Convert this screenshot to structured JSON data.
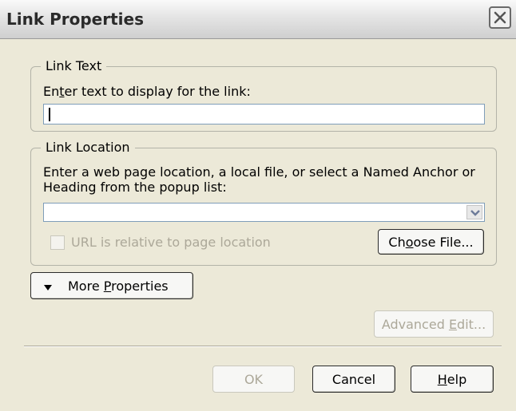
{
  "dialog": {
    "title": "Link Properties",
    "close_icon": "close-icon"
  },
  "link_text": {
    "legend": "Link Text",
    "prompt_pre": "En",
    "prompt_key": "t",
    "prompt_post": "er text to display for the link:",
    "value": ""
  },
  "link_location": {
    "legend": "Link Location",
    "prompt_line1": "Enter a web page location, a local file, or select a Named Anchor or",
    "prompt_line2": "Heading from the popup list:",
    "value": "",
    "relative_label": "URL is relative to page location",
    "relative_checked": false,
    "choose_pre": "Ch",
    "choose_key": "o",
    "choose_post": "ose File..."
  },
  "more_properties": {
    "pre": "More ",
    "key": "P",
    "post": "roperties"
  },
  "advanced_edit": {
    "pre": "Advanced ",
    "key": "E",
    "post": "dit..."
  },
  "footer": {
    "ok_label": "OK",
    "cancel_label": "Cancel",
    "help_key": "H",
    "help_post": "elp"
  }
}
